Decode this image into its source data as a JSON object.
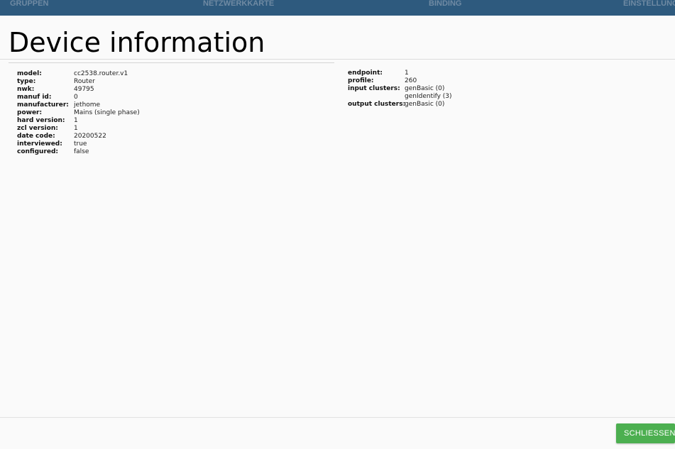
{
  "nav": {
    "tabs": [
      "GRUPPEN",
      "NETZWERKKARTE",
      "BINDING",
      "EINSTELLUNG"
    ]
  },
  "dialog": {
    "title": "Device information",
    "close_label": "SCHLIESSEN"
  },
  "device": [
    {
      "label": "model:",
      "value": "cc2538.router.v1"
    },
    {
      "label": "type:",
      "value": "Router"
    },
    {
      "label": "nwk:",
      "value": "49795"
    },
    {
      "label": "manuf id:",
      "value": "0"
    },
    {
      "label": "manufacturer:",
      "value": "jethome"
    },
    {
      "label": "power:",
      "value": "Mains (single phase)"
    },
    {
      "label": "hard version:",
      "value": "1"
    },
    {
      "label": "zcl version:",
      "value": "1"
    },
    {
      "label": "date code:",
      "value": "20200522"
    },
    {
      "label": "interviewed:",
      "value": "true"
    },
    {
      "label": "configured:",
      "value": "false"
    }
  ],
  "endpoint": {
    "endpoint_label": "endpoint:",
    "endpoint_value": "1",
    "profile_label": "profile:",
    "profile_value": "260",
    "input_clusters_label": "input clusters:",
    "input_clusters": [
      "genBasic (0)",
      "genIdentify (3)"
    ],
    "output_clusters_label": "output clusters:",
    "output_clusters": [
      "genBasic (0)"
    ]
  },
  "colors": {
    "nav_bg": "#2e5a7e",
    "button_bg": "#4caf50"
  }
}
